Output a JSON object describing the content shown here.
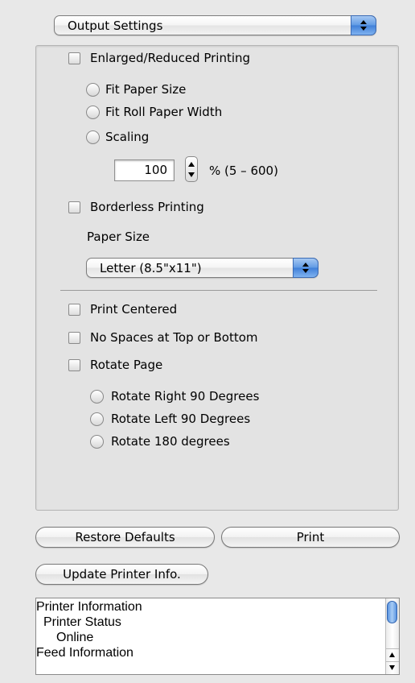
{
  "section_popup": {
    "value": "Output Settings",
    "icon": "popup-arrows-icon"
  },
  "enlarged_reduced": {
    "label": "Enlarged/Reduced Printing",
    "checked": false,
    "options": [
      "Fit Paper Size",
      "Fit Roll Paper Width",
      "Scaling"
    ],
    "selected": null
  },
  "scaling": {
    "value": "100",
    "range_label": "% (5 – 600)"
  },
  "borderless": {
    "label": "Borderless Printing",
    "checked": false,
    "paper_size_label": "Paper Size",
    "paper_size_value": "Letter (8.5\"x11\")"
  },
  "print_centered": {
    "label": "Print Centered",
    "checked": false
  },
  "no_spaces": {
    "label": "No Spaces at Top or Bottom",
    "checked": false
  },
  "rotate_page": {
    "label": "Rotate Page",
    "checked": false,
    "options": [
      "Rotate Right 90 Degrees",
      "Rotate Left 90 Degrees",
      "Rotate 180 degrees"
    ],
    "selected": null
  },
  "buttons": {
    "restore_defaults": "Restore Defaults",
    "print": "Print",
    "update_printer_info": "Update Printer Info."
  },
  "printer_info": {
    "lines": [
      "Printer Information",
      "Printer Status",
      "Online",
      "Feed Information"
    ]
  },
  "colors": {
    "accent_blue": "#3f7fd8",
    "panel_bg": "#e3e3e3",
    "window_bg": "#e8e8e8"
  }
}
